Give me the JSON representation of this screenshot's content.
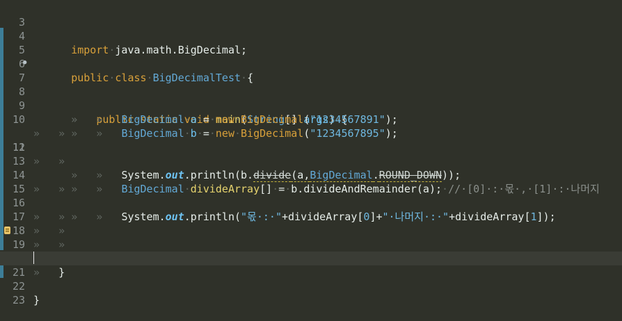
{
  "editor": {
    "line_numbers": [
      "3",
      "4",
      "5",
      "6",
      "7",
      "8",
      "9",
      "10",
      "11",
      "12",
      "13",
      "14",
      "15",
      "16",
      "17",
      "18",
      "19",
      "20",
      "21",
      "22",
      "23"
    ],
    "lines": {
      "l3": {
        "kw": "import",
        "sep": "·",
        "rest": "java.math.BigDecimal;"
      },
      "l5": {
        "kw1": "public",
        "kw2": "class",
        "name": "BigDecimalTest",
        "brace": "{"
      },
      "l7": {
        "kw1": "public",
        "kw2": "static",
        "kw3": "void",
        "method": "main",
        "open": "(",
        "type": "String",
        "arr": "[]",
        "arg": "args",
        "close": ")",
        "brace": "{"
      },
      "l8": {
        "type": "BigDecimal",
        "var": "a",
        "eq": "=",
        "kw": "new",
        "cls": "BigDecimal",
        "open": "(",
        "str": "\"1234567891\"",
        "close": ");"
      },
      "l9": {
        "type": "BigDecimal",
        "var": "b",
        "eq": "=",
        "kw": "new",
        "cls": "BigDecimal",
        "open": "(",
        "str": "\"1234567895\"",
        "close": ");"
      },
      "l11": {
        "sys": "System",
        "dot1": ".",
        "out": "out",
        "dot2": ".",
        "println": "println",
        "open": "(b.",
        "divide": "divide",
        "args1": "(a,",
        "bd": "BigDecimal",
        "dot3": ".",
        "rd": "ROUND_DOWN",
        "close": "));"
      },
      "l13": {
        "type": "BigDecimal",
        "var": "divideArray",
        "arr": "[]",
        "eq": "=",
        "call": "b.divideAndRemainder(a);",
        "comment": "//·[0]·:·몫·,·[1]·:·나머지"
      },
      "l15": {
        "sys": "System",
        "dot1": ".",
        "out": "out",
        "dot2": ".",
        "println": "println",
        "open": "(",
        "str1": "\"몫·:·\"",
        "plus1": "+divideArray[",
        "i0": "0",
        "mid": "]+",
        "str2": "\"·나머지·:·\"",
        "plus2": "+divideArray[",
        "i1": "1",
        "close": "]);"
      },
      "l20": {
        "brace": "}"
      },
      "l22": {
        "brace": "}"
      }
    },
    "tab_marker": "»"
  }
}
